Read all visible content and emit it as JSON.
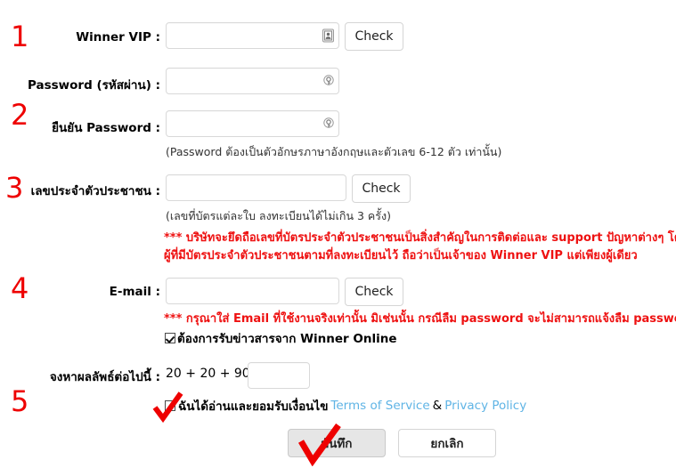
{
  "steps": {
    "one": "1",
    "two": "2",
    "three": "3",
    "four": "4",
    "five": "5"
  },
  "colors": {
    "step_number": "#ee0000",
    "warning_text": "#ee1111",
    "link": "#5fb4e5",
    "field_border": "#d9d9d9",
    "button_primary_bg": "#e6e6e6"
  },
  "fields": {
    "winner_vip": {
      "label": "Winner VIP :",
      "value": "",
      "placeholder": "",
      "icon": "contact-card-icon",
      "check_button": "Check"
    },
    "password": {
      "label": "Password (รหัสผ่าน) :",
      "value": "",
      "placeholder": "",
      "icon": "key-icon"
    },
    "confirm_password": {
      "label": "ยืนยัน Password :",
      "value": "",
      "placeholder": "",
      "icon": "key-icon",
      "hint": "(Password ต้องเป็นตัวอักษรภาษาอังกฤษและตัวเลข 6-12 ตัว เท่านั้น)"
    },
    "national_id": {
      "label": "เลขประจำตัวประชาชน :",
      "value": "",
      "placeholder": "",
      "check_button": "Check",
      "hint": "(เลขที่บัตรแต่ละใบ ลงทะเบียนได้ไม่เกิน 3 ครั้ง)",
      "warning_line1": "*** บริษัทจะยึดถือเลขที่บัตรประจำตัวประชาชนเป็นสิ่งสำคัญในการติดต่อและ support ปัญหาต่างๆ โดย",
      "warning_line2": "ผู้ที่มีบัตรประจำตัวประชาชนตามที่ลงทะเบียนไว้ ถือว่าเป็นเจ้าของ Winner VIP แต่เพียงผู้เดียว"
    },
    "email": {
      "label": "E-mail :",
      "value": "",
      "placeholder": "",
      "check_button": "Check",
      "warning": "*** กรุณาใส่ Email ที่ใช้งานจริงเท่านั้น มิเช่นนั้น กรณีลืม password จะไม่สามารถแจ้งลืม password ได้"
    },
    "newsletter": {
      "label": "ต้องการรับข่าวสารจาก Winner Online",
      "checked": true
    },
    "captcha": {
      "label": "จงหาผลลัพธ์ต่อไปนี้ :",
      "question": "20 + 20 + 90 =",
      "value": "",
      "placeholder": ""
    },
    "terms": {
      "checked": false,
      "text": "ฉันได้อ่านและยอมรับเงื่อนไข",
      "tos_link": "Terms of Service",
      "separator": "&",
      "privacy_link": "Privacy Policy"
    }
  },
  "actions": {
    "submit": "บันทึก",
    "cancel": "ยกเลิก"
  }
}
